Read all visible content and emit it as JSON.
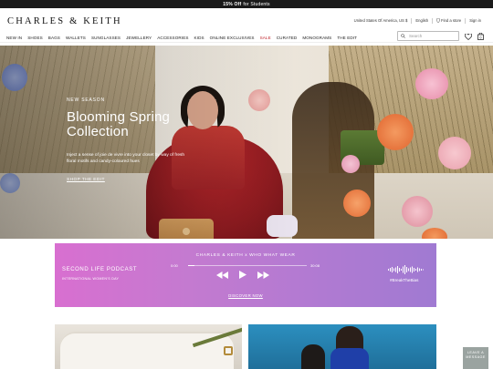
{
  "promo_bar": {
    "highlight": "15% Off",
    "text": "for Students"
  },
  "brand": {
    "logo": "CHARLES & KEITH"
  },
  "utility_nav": {
    "region": "United States Of America, US $",
    "language": "English",
    "store": "Find a store",
    "signin": "Sign in"
  },
  "main_nav": [
    {
      "label": "NEW IN",
      "sale": false
    },
    {
      "label": "SHOES",
      "sale": false
    },
    {
      "label": "BAGS",
      "sale": false
    },
    {
      "label": "WALLETS",
      "sale": false
    },
    {
      "label": "SUNGLASSES",
      "sale": false
    },
    {
      "label": "JEWELLERY",
      "sale": false
    },
    {
      "label": "ACCESSORIES",
      "sale": false
    },
    {
      "label": "KIDS",
      "sale": false
    },
    {
      "label": "ONLINE EXCLUSIVES",
      "sale": false
    },
    {
      "label": "SALE",
      "sale": true
    },
    {
      "label": "CURATED",
      "sale": false
    },
    {
      "label": "MONOGRAMS",
      "sale": false
    },
    {
      "label": "THE EDIT",
      "sale": false
    }
  ],
  "search": {
    "placeholder": "Search"
  },
  "icons": {
    "wishlist": "heart-icon",
    "cart": "bag-icon",
    "search": "search-icon"
  },
  "hero": {
    "eyebrow": "NEW SEASON",
    "title": "Blooming Spring Collection",
    "description": "Inject a sense of joie de vivre into your closet by way of fresh floral motifs and candy-coloured hues",
    "cta": "SHOP THE EDIT",
    "slides": 3,
    "active_slide": 1
  },
  "podcast_banner": {
    "heading": "CHARLES & KEITH x WHO WHAT WEAR",
    "title": "SECOND LIFE PODCAST",
    "subtitle": "INTERNATIONAL WOMEN'S DAY",
    "time_start": "0:00",
    "time_end": "30:08",
    "progress": 0.05,
    "cta": "DISCOVER NOW",
    "hashtag": "#BreakTheBias"
  },
  "leave_message": {
    "label": "LEAVE A MESSAGE"
  }
}
